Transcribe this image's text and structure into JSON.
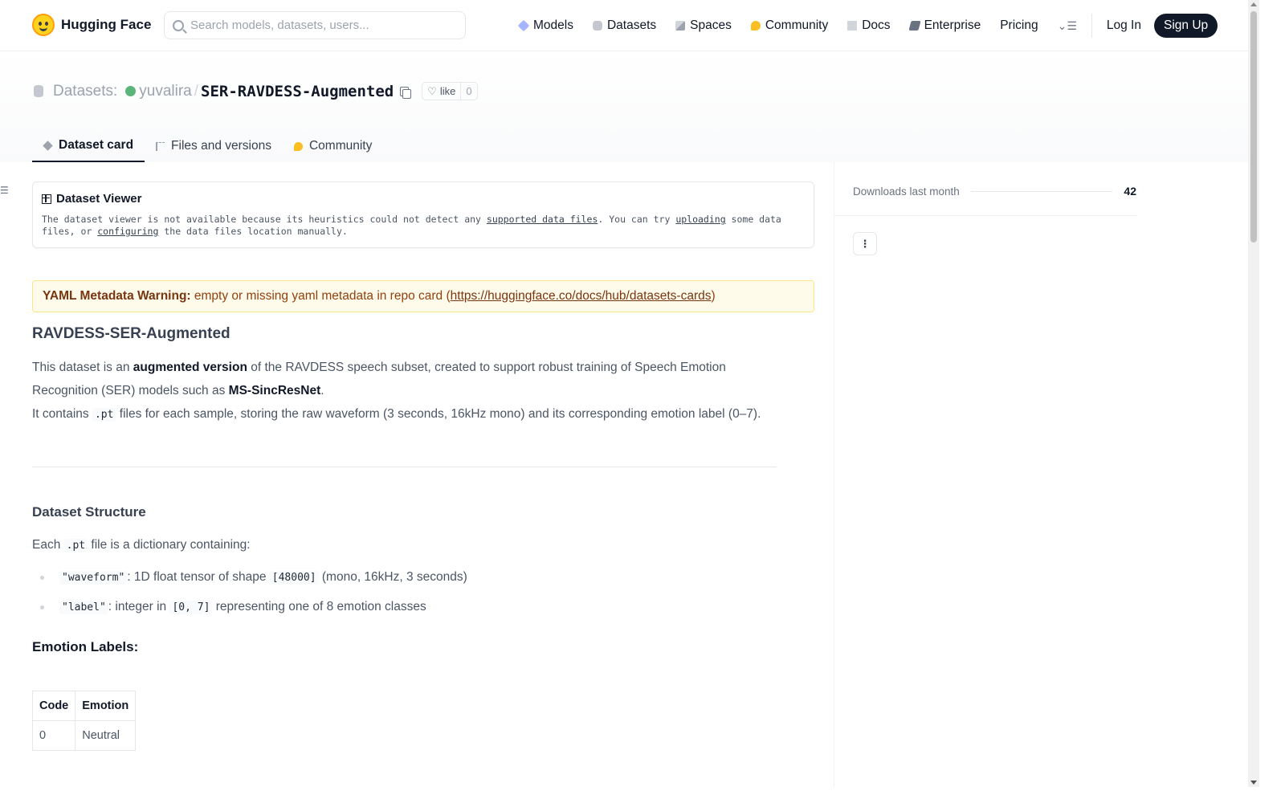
{
  "nav": {
    "brand": "Hugging Face",
    "search_placeholder": "Search models, datasets, users...",
    "links": [
      {
        "label": "Models",
        "icon": "cube-icon"
      },
      {
        "label": "Datasets",
        "icon": "database-icon"
      },
      {
        "label": "Spaces",
        "icon": "spaces-icon"
      },
      {
        "label": "Community",
        "icon": "community-icon"
      },
      {
        "label": "Docs",
        "icon": "book-icon"
      },
      {
        "label": "Enterprise",
        "icon": "enterprise-icon"
      },
      {
        "label": "Pricing"
      }
    ],
    "login": "Log In",
    "signup": "Sign Up"
  },
  "header": {
    "section": "Datasets:",
    "user": "yuvalira",
    "separator": "/",
    "repo": "SER-RAVDESS-Augmented",
    "like_label": "like",
    "like_count": "0",
    "tabs": [
      {
        "label": "Dataset card",
        "active": true
      },
      {
        "label": "Files and versions",
        "active": false
      },
      {
        "label": "Community",
        "active": false
      }
    ]
  },
  "viewer": {
    "title": "Dataset Viewer",
    "text_1": "The dataset viewer is not available because its heuristics could not detect any ",
    "link_1": "supported data files",
    "text_2": ". You can try ",
    "link_2": "uploading",
    "text_3": " some data files, or ",
    "link_3": "configuring",
    "text_4": " the data files location manually."
  },
  "warning": {
    "label": "YAML Metadata Warning:",
    "text": " empty or missing yaml metadata in repo card (",
    "link": "https://huggingface.co/docs/hub/datasets-cards",
    "close": ")"
  },
  "card": {
    "title": "RAVDESS-SER-Augmented",
    "p1_a": "This dataset is an ",
    "p1_b": "augmented version",
    "p1_c": " of the RAVDESS speech subset, created to support robust training of Speech Emotion Recognition (SER) models such as ",
    "p1_d": "MS-SincResNet",
    "p1_e": ".",
    "p2_a": "It contains ",
    "p2_code": ".pt",
    "p2_b": " files for each sample, storing the raw waveform (3 seconds, 16kHz mono) and its corresponding emotion label (0–7).",
    "structure_title": "Dataset Structure",
    "structure_a": "Each ",
    "structure_code": ".pt",
    "structure_b": " file is a dictionary containing:",
    "fields": [
      {
        "code": "\"waveform\"",
        "text_a": ": 1D float tensor of shape ",
        "code2": "[48000]",
        "text_b": " (mono, 16kHz, 3 seconds)"
      },
      {
        "code": "\"label\"",
        "text_a": ": integer in ",
        "code2": "[0, 7]",
        "text_b": " representing one of 8 emotion classes"
      }
    ],
    "labels_title": "Emotion Labels:",
    "table_headers": [
      "Code",
      "Emotion"
    ],
    "table_rows": [
      [
        "0",
        "Neutral"
      ]
    ]
  },
  "sidebar": {
    "downloads_label": "Downloads last month",
    "downloads_value": "42",
    "more": "⋮"
  }
}
